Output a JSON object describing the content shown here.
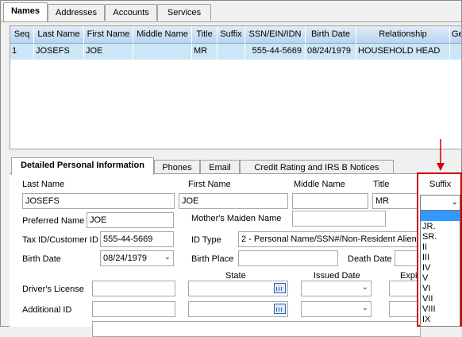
{
  "top_tabs": [
    "Names",
    "Addresses",
    "Accounts",
    "Services"
  ],
  "grid": {
    "columns": [
      "Seq",
      "Last Name",
      "First Name",
      "Middle Name",
      "Title",
      "Suffix",
      "SSN/EIN/IDN",
      "Birth Date",
      "Relationship",
      "Ge"
    ],
    "rows": [
      [
        "1",
        "JOSEFS",
        "JOE",
        "",
        "MR",
        "",
        "555-44-5669",
        "08/24/1979",
        "HOUSEHOLD HEAD",
        ""
      ]
    ]
  },
  "detail_tabs": [
    "Detailed Personal Information",
    "Phones",
    "Email",
    "Credit Rating and IRS B Notices"
  ],
  "form": {
    "last_name_label": "Last Name",
    "first_name_label": "First Name",
    "middle_name_label": "Middle Name",
    "title_label": "Title",
    "suffix_label": "Suffix",
    "last_name": "JOSEFS",
    "first_name": "JOE",
    "middle_name": "",
    "title": "MR",
    "preferred_name_label": "Preferred Name",
    "preferred_name": "JOE",
    "mothers_maiden_label": "Mother's Maiden Name",
    "mothers_maiden": "",
    "tax_id_label": "Tax ID/Customer ID",
    "tax_id": "555-44-5669",
    "id_type_label": "ID Type",
    "id_type": "2 - Personal Name/SSN#/Non-Resident Alien",
    "birth_date_label": "Birth Date",
    "birth_date": "08/24/1979",
    "birth_place_label": "Birth Place",
    "birth_place": "",
    "death_date_label": "Death Date",
    "state_label": "State",
    "issued_date_label": "Issued Date",
    "expiry_label": "Expi",
    "drivers_license_label": "Driver's License",
    "additional_id_label": "Additional ID"
  },
  "suffix_options": [
    "",
    "JR.",
    "SR.",
    "II",
    "III",
    "IV",
    "V",
    "VI",
    "VII",
    "VIII",
    "IX"
  ],
  "colors": {
    "highlight": "#d00000",
    "selected_row": "#cde6f7",
    "list_selected": "#3399ff"
  }
}
